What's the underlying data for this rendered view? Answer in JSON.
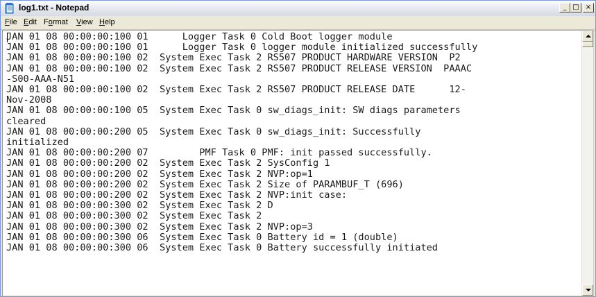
{
  "window": {
    "title": "log1.txt - Notepad",
    "controls": {
      "minimize": "_",
      "maximize": "□",
      "close": "×"
    }
  },
  "menu": {
    "items": [
      {
        "label": "File",
        "accel": "F",
        "rest": "ile"
      },
      {
        "label": "Edit",
        "accel": "E",
        "rest": "dit"
      },
      {
        "label": "Format",
        "pre": "F",
        "accel": "o",
        "rest": "rmat"
      },
      {
        "label": "View",
        "accel": "V",
        "rest": "iew"
      },
      {
        "label": "Help",
        "accel": "H",
        "rest": "elp"
      }
    ]
  },
  "document": {
    "lines": [
      "JAN 01 08 00:00:00:100 01      Logger Task 0 Cold Boot logger module",
      "JAN 01 08 00:00:00:100 01      Logger Task 0 logger module initialized successfully",
      "JAN 01 08 00:00:00:100 02  System Exec Task 2 RS507 PRODUCT HARDWARE VERSION  P2",
      "JAN 01 08 00:00:00:100 02  System Exec Task 2 RS507 PRODUCT RELEASE VERSION  PAAAC",
      "-S00-AAA-N51",
      "JAN 01 08 00:00:00:100 02  System Exec Task 2 RS507 PRODUCT RELEASE DATE      12-",
      "Nov-2008",
      "JAN 01 08 00:00:00:100 05  System Exec Task 0 sw_diags_init: SW diags parameters",
      "cleared",
      "JAN 01 08 00:00:00:200 05  System Exec Task 0 sw_diags_init: Successfully",
      "initialized",
      "JAN 01 08 00:00:00:200 07         PMF Task 0 PMF: init passed successfully.",
      "JAN 01 08 00:00:00:200 02  System Exec Task 2 SysConfig 1",
      "JAN 01 08 00:00:00:200 02  System Exec Task 2 NVP:op=1",
      "JAN 01 08 00:00:00:200 02  System Exec Task 2 Size of PARAMBUF_T (696)",
      "JAN 01 08 00:00:00:200 02  System Exec Task 2 NVP:init case:",
      "JAN 01 08 00:00:00:300 02  System Exec Task 2 D",
      "JAN 01 08 00:00:00:300 02  System Exec Task 2",
      "JAN 01 08 00:00:00:300 02  System Exec Task 2 NVP:op=3",
      "JAN 01 08 00:00:00:300 06  System Exec Task 0 Battery id = 1 (double)",
      "JAN 01 08 00:00:00:300 06  System Exec Task 0 Battery successfully initiated"
    ]
  },
  "colors": {
    "titlebar": "#e6e9ef",
    "chrome": "#ece9d8",
    "text": "#1a1a1a"
  }
}
